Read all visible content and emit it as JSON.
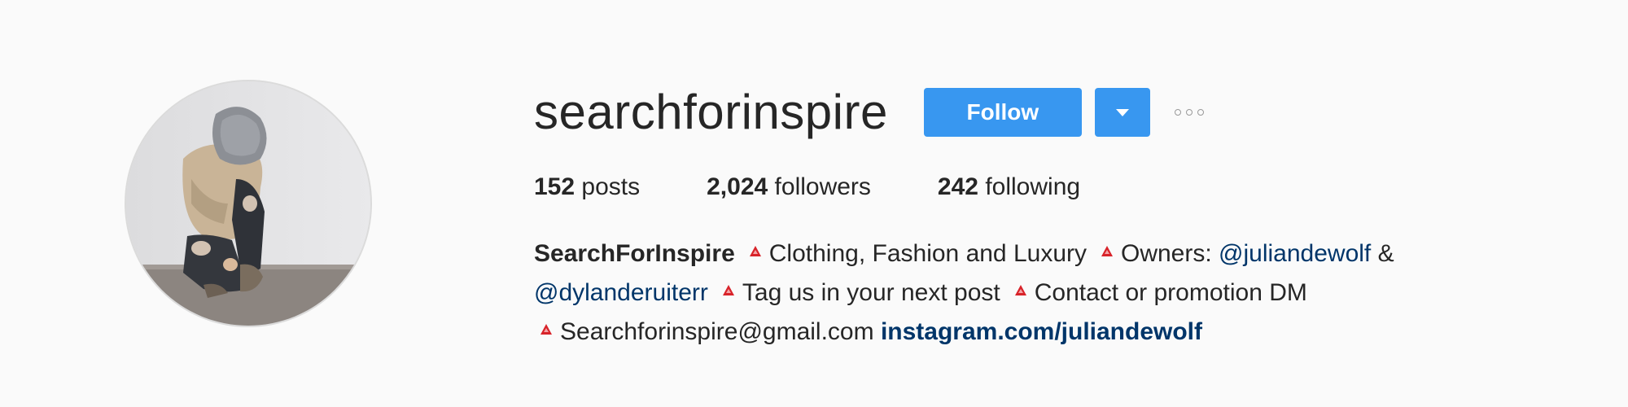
{
  "profile": {
    "username": "searchforinspire",
    "follow_label": "Follow",
    "stats": {
      "posts_count": "152",
      "posts_label": "posts",
      "followers_count": "2,024",
      "followers_label": "followers",
      "following_count": "242",
      "following_label": "following"
    },
    "bio": {
      "name": "SearchForInspire",
      "segment1": "Clothing, Fashion and Luxury",
      "segment2_prefix": "Owners: ",
      "mention1": "@juliandewolf",
      "ampersand": " &",
      "mention2": "@dylanderuiterr",
      "segment3": "Tag us in your next post",
      "segment4": "Contact or promotion DM",
      "email": "Searchforinspire@gmail.com",
      "website": "instagram.com/juliandewolf"
    }
  },
  "icons": {
    "bullet": "red-triangle-icon",
    "dropdown": "chevron-down-icon",
    "more": "more-options-icon"
  },
  "colors": {
    "button_blue": "#3897f0",
    "link_blue": "#003569",
    "background": "#fafafa",
    "bullet_red": "#d8232a"
  }
}
